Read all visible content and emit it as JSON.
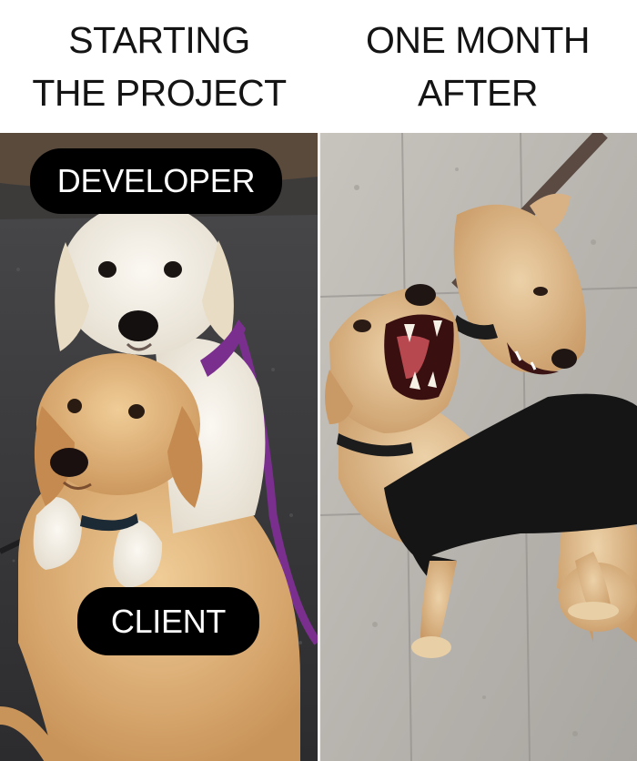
{
  "captions": {
    "left": {
      "line1": "STARTING",
      "line2": "THE PROJECT"
    },
    "right": {
      "line1": "ONE MONTH",
      "line2": "AFTER"
    }
  },
  "labels": {
    "top": "DEVELOPER",
    "bottom": "CLIENT"
  },
  "colors": {
    "background": "#ffffff",
    "caption_text": "#141414",
    "label_pill": "#000000",
    "label_text": "#ffffff",
    "leash": "#7a2f8f",
    "puppy_white": "#f3efe6",
    "puppy_golden": "#e0b27a",
    "lab_tan": "#d9b489",
    "shirt": "#151515"
  }
}
